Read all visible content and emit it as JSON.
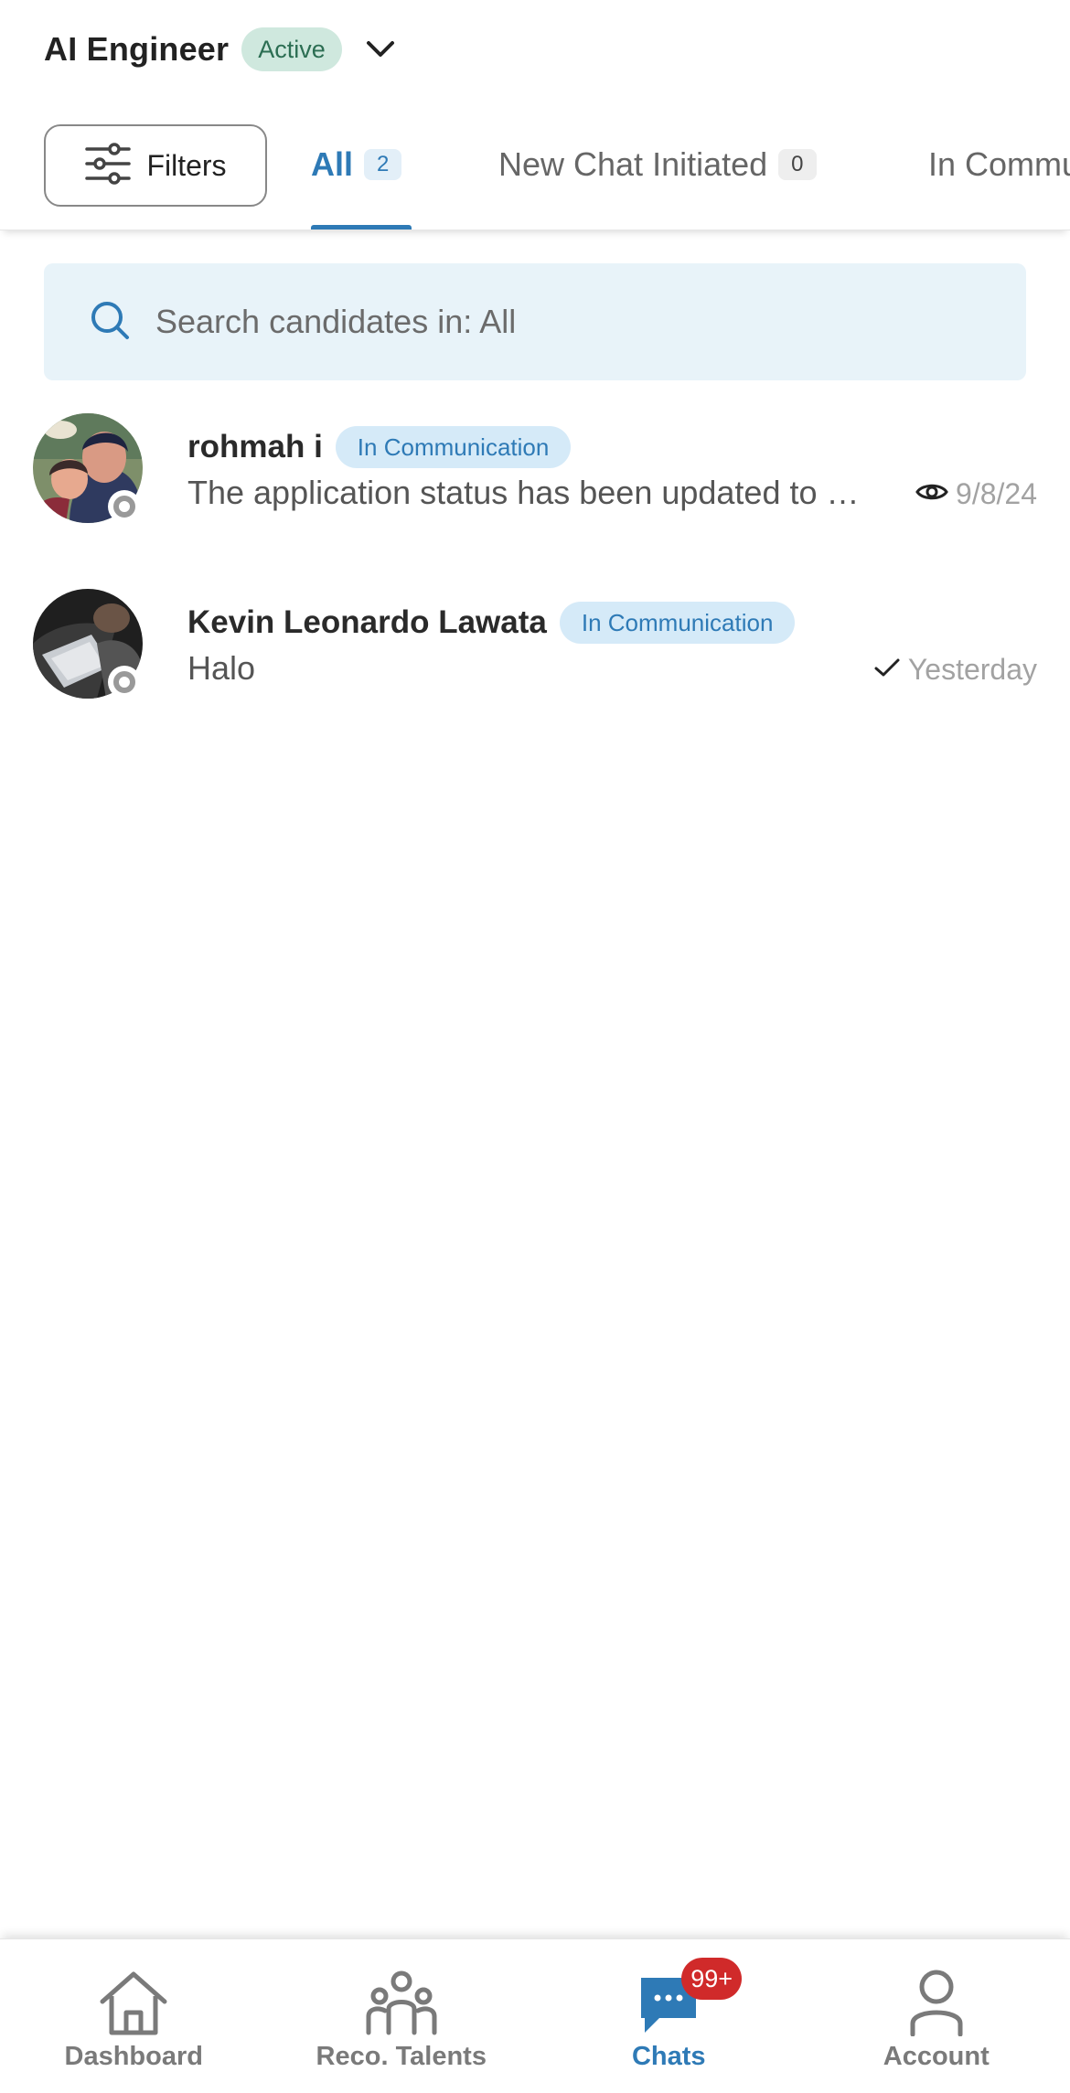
{
  "job": {
    "title": "AI Engineer",
    "status": "Active"
  },
  "filters": {
    "label": "Filters"
  },
  "tabs": [
    {
      "label": "All",
      "count": "2",
      "active": true
    },
    {
      "label": "New Chat Initiated",
      "count": "0",
      "active": false
    },
    {
      "label": "In Commu",
      "count": "",
      "active": false
    }
  ],
  "search": {
    "placeholder": "Search candidates in: All",
    "value": ""
  },
  "chats": [
    {
      "name": "rohmah i",
      "status": "In Communication",
      "message": "The application status has been updated to …",
      "time": "9/8/24",
      "indicator": "eye-icon"
    },
    {
      "name": "Kevin Leonardo Lawata",
      "status": "In Communication",
      "message": "Halo",
      "time": "Yesterday",
      "indicator": "check-icon"
    }
  ],
  "nav": [
    {
      "label": "Dashboard",
      "icon": "home-icon",
      "active": false
    },
    {
      "label": "Reco. Talents",
      "icon": "people-icon",
      "active": false
    },
    {
      "label": "Chats",
      "icon": "chat-icon",
      "active": true,
      "badge": "99+"
    },
    {
      "label": "Account",
      "icon": "person-icon",
      "active": false
    }
  ],
  "colors": {
    "primary": "#2e7ab6",
    "active_badge_bg": "#cfe8de",
    "status_tag_bg": "#d5eaf8",
    "search_bg": "#e8f3f9",
    "notification_badge": "#d02a2a"
  }
}
